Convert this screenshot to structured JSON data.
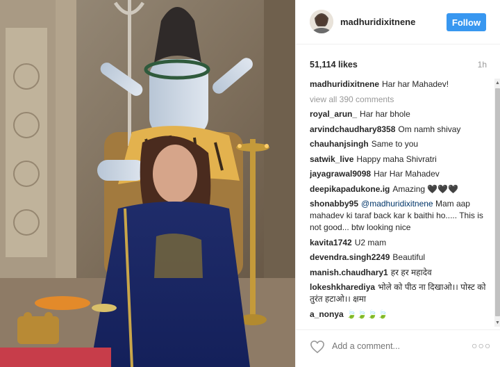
{
  "post": {
    "username": "madhuridixitnene",
    "follow_label": "Follow",
    "likes": "51,114 likes",
    "time": "1h",
    "view_all": "view all 390 comments",
    "add_comment_placeholder": "Add a comment...",
    "more_icon": "more-options-icon",
    "like_icon": "heart-icon"
  },
  "comments": [
    {
      "author": "madhuridixitnene",
      "text": "Har har Mahadev!"
    },
    {
      "author": "royal_arun_",
      "text": "Har har bhole"
    },
    {
      "author": "arvindchaudhary8358",
      "text": "Om namh shivay"
    },
    {
      "author": "chauhanjsingh",
      "text": "Same to you"
    },
    {
      "author": "satwik_live",
      "text": "Happy maha Shivratri"
    },
    {
      "author": "jayagrawal9098",
      "text": "Har Har Mahadev"
    },
    {
      "author": "deepikapadukone.ig",
      "text": "Amazing 🖤🖤🖤"
    },
    {
      "author": "shonabby95",
      "mention": "@madhuridixitnene",
      "text": "Mam aap mahadev ki taraf back kar k baithi ho..... This is not good... btw looking nice"
    },
    {
      "author": "kavita1742",
      "text": "U2 mam"
    },
    {
      "author": "devendra.singh2249",
      "text": "Beautiful"
    },
    {
      "author": "manish.chaudhary1",
      "text": "हर हर महादेव"
    },
    {
      "author": "lokeshkharediya",
      "text": "भोले को पीठ ना दिखाओ।। पोस्ट को तुरंत हटाओ।। क्षमा"
    },
    {
      "author": "a_nonya",
      "text": "🍃🍃🍃🍃"
    }
  ],
  "colors": {
    "follow_button": "#3897f0",
    "text": "#262626",
    "muted": "#999999",
    "mention": "#003569"
  }
}
